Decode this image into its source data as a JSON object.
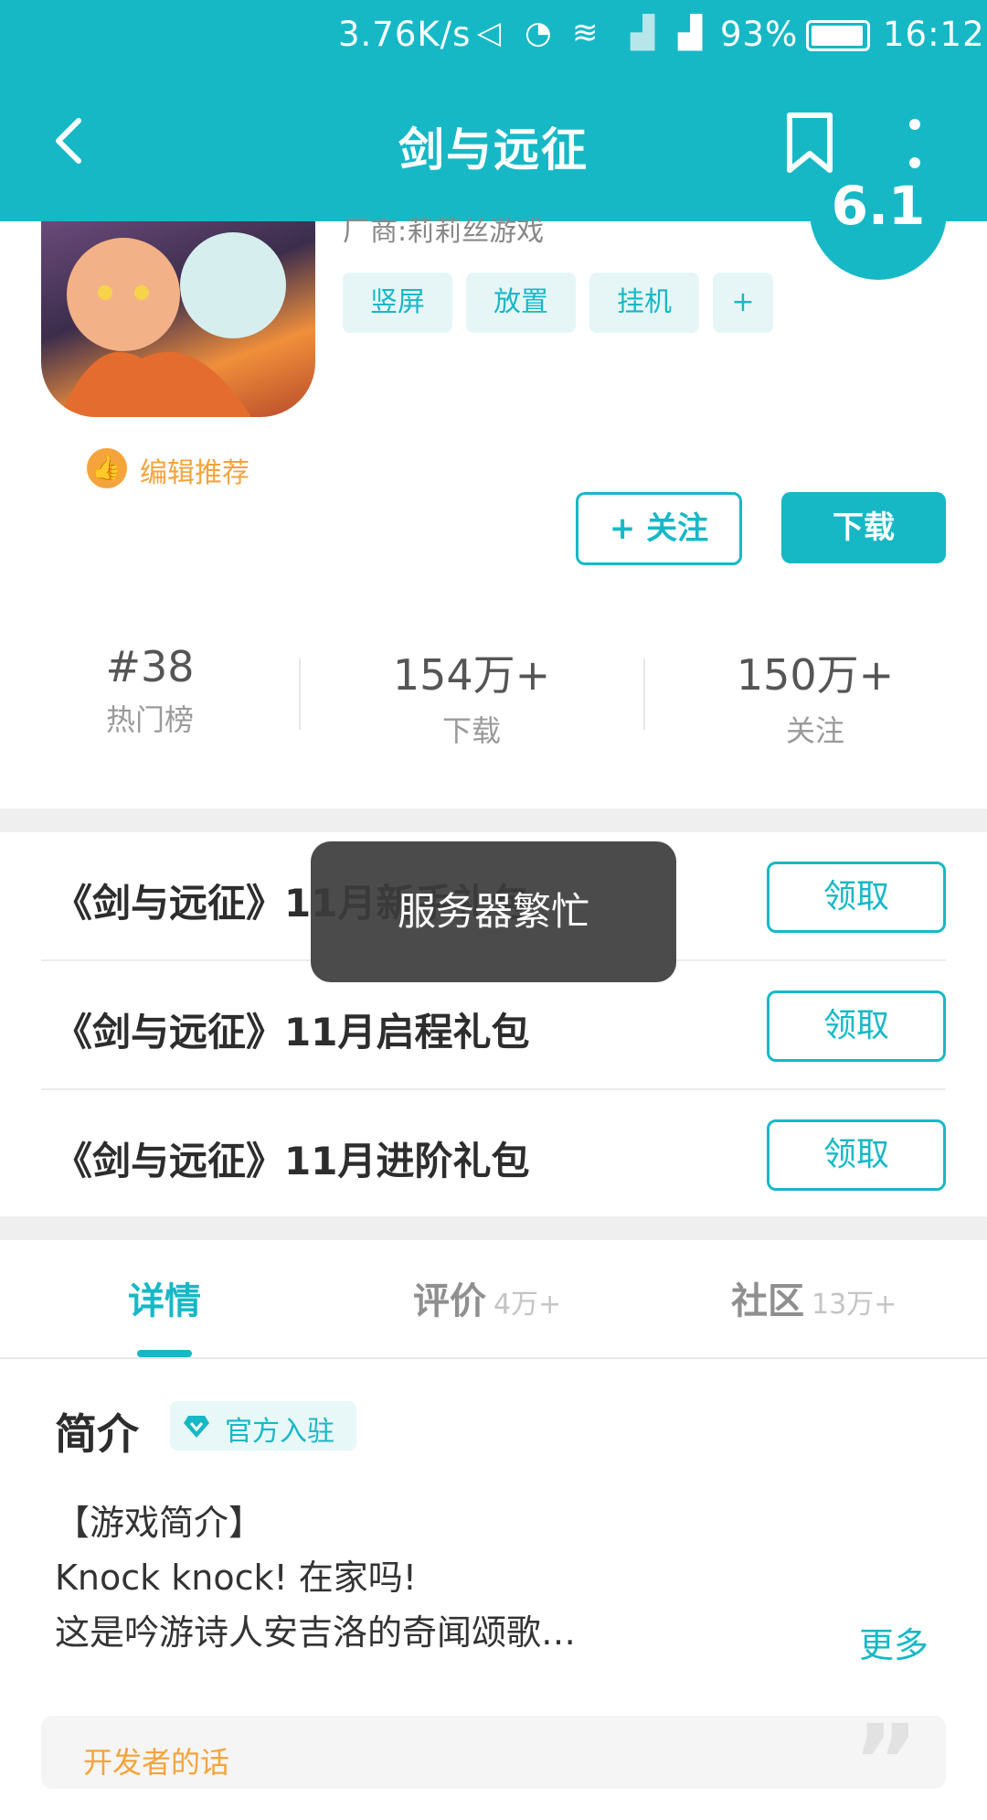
{
  "status_bar": {
    "speed": "3.76K/s",
    "battery": "93%",
    "time": "16:12",
    "icons": [
      "mute-icon",
      "alarm-icon",
      "wifi-icon",
      "signal-icon",
      "signal-icon",
      "battery-icon"
    ]
  },
  "nav": {
    "title": "剑与远征",
    "icons": [
      "back-icon",
      "bookmark-icon",
      "more-icon"
    ]
  },
  "game": {
    "developer": "厂商:莉莉丝游戏",
    "tags": [
      "竖屏",
      "放置",
      "挂机",
      "+"
    ],
    "score": "6.1",
    "recommend_label": "编辑推荐",
    "follow_label": "+ 关注",
    "download_label": "下载"
  },
  "stats": [
    {
      "value": "#38",
      "label": "热门榜"
    },
    {
      "value": "154万+",
      "label": "下载"
    },
    {
      "value": "150万+",
      "label": "关注"
    }
  ],
  "gifts": [
    {
      "title": "《剑与远征》11月新手礼包",
      "action": "领取"
    },
    {
      "title": "《剑与远征》11月启程礼包",
      "action": "领取"
    },
    {
      "title": "《剑与远征》11月进阶礼包",
      "action": "领取"
    }
  ],
  "toast": "服务器繁忙",
  "tabs": [
    {
      "label": "详情",
      "count": ""
    },
    {
      "label": "评价",
      "count": "4万+"
    },
    {
      "label": "社区",
      "count": "13万+"
    }
  ],
  "intro": {
    "title": "简介",
    "official_badge": "官方入驻",
    "lines": [
      "【游戏简介】",
      "Knock knock! 在家吗!",
      "这是吟游诗人安吉洛的奇闻颂歌…"
    ],
    "more_label": "更多"
  },
  "developer_card": {
    "label": "开发者的话"
  },
  "colors": {
    "accent": "#17b8c6",
    "orange": "#f5a33b"
  }
}
